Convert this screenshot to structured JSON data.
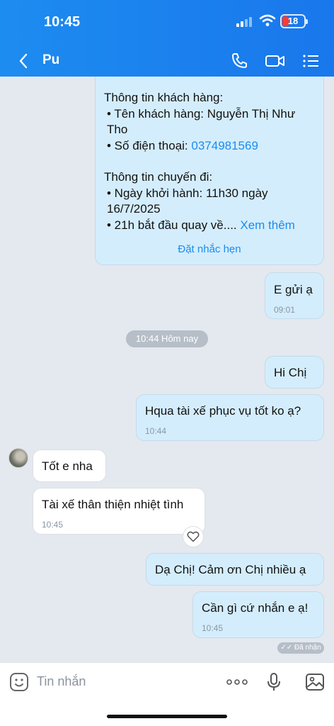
{
  "status_bar": {
    "time": "10:45",
    "battery": "18"
  },
  "header": {
    "contact_name": "Pu"
  },
  "card": {
    "customer_heading": "Thông tin khách hàng:",
    "customer_name_line": "• Tên khách hàng: Nguyễn Thị Như Tho",
    "phone_label": "• Số điện thoại: ",
    "phone_value": "0374981569",
    "trip_heading": "Thông tin chuyến đi:",
    "departure_line": "• Ngày khởi hành: 11h30 ngày 16/7/2025",
    "return_line": "• 21h bắt đầu quay về....",
    "see_more": "Xem thêm",
    "reminder": "Đặt nhắc hẹn"
  },
  "messages": {
    "m1": {
      "text": "E gửi ạ",
      "time": "09:01"
    },
    "date_separator": "10:44 Hôm nay",
    "m2": {
      "text": "Hi Chị"
    },
    "m3": {
      "text": "Hqua tài xế phục vụ tốt ko ạ?",
      "time": "10:44"
    },
    "m4": {
      "text": "Tốt e nha"
    },
    "m5": {
      "text": "Tài xế thân thiện nhiệt tình",
      "time": "10:45"
    },
    "m6": {
      "text": "Dạ Chị! Cảm ơn Chị nhiều ạ"
    },
    "m7": {
      "text": "Cần gì cứ nhắn e ạ!",
      "time": "10:45"
    },
    "seen_label": "Đã nhận"
  },
  "input": {
    "placeholder": "Tin nhắn"
  },
  "icons": [
    "chevron-left-icon",
    "phone-icon",
    "video-icon",
    "menu-icon",
    "heart-icon",
    "sticker-icon",
    "more-icon",
    "mic-icon",
    "image-icon"
  ]
}
